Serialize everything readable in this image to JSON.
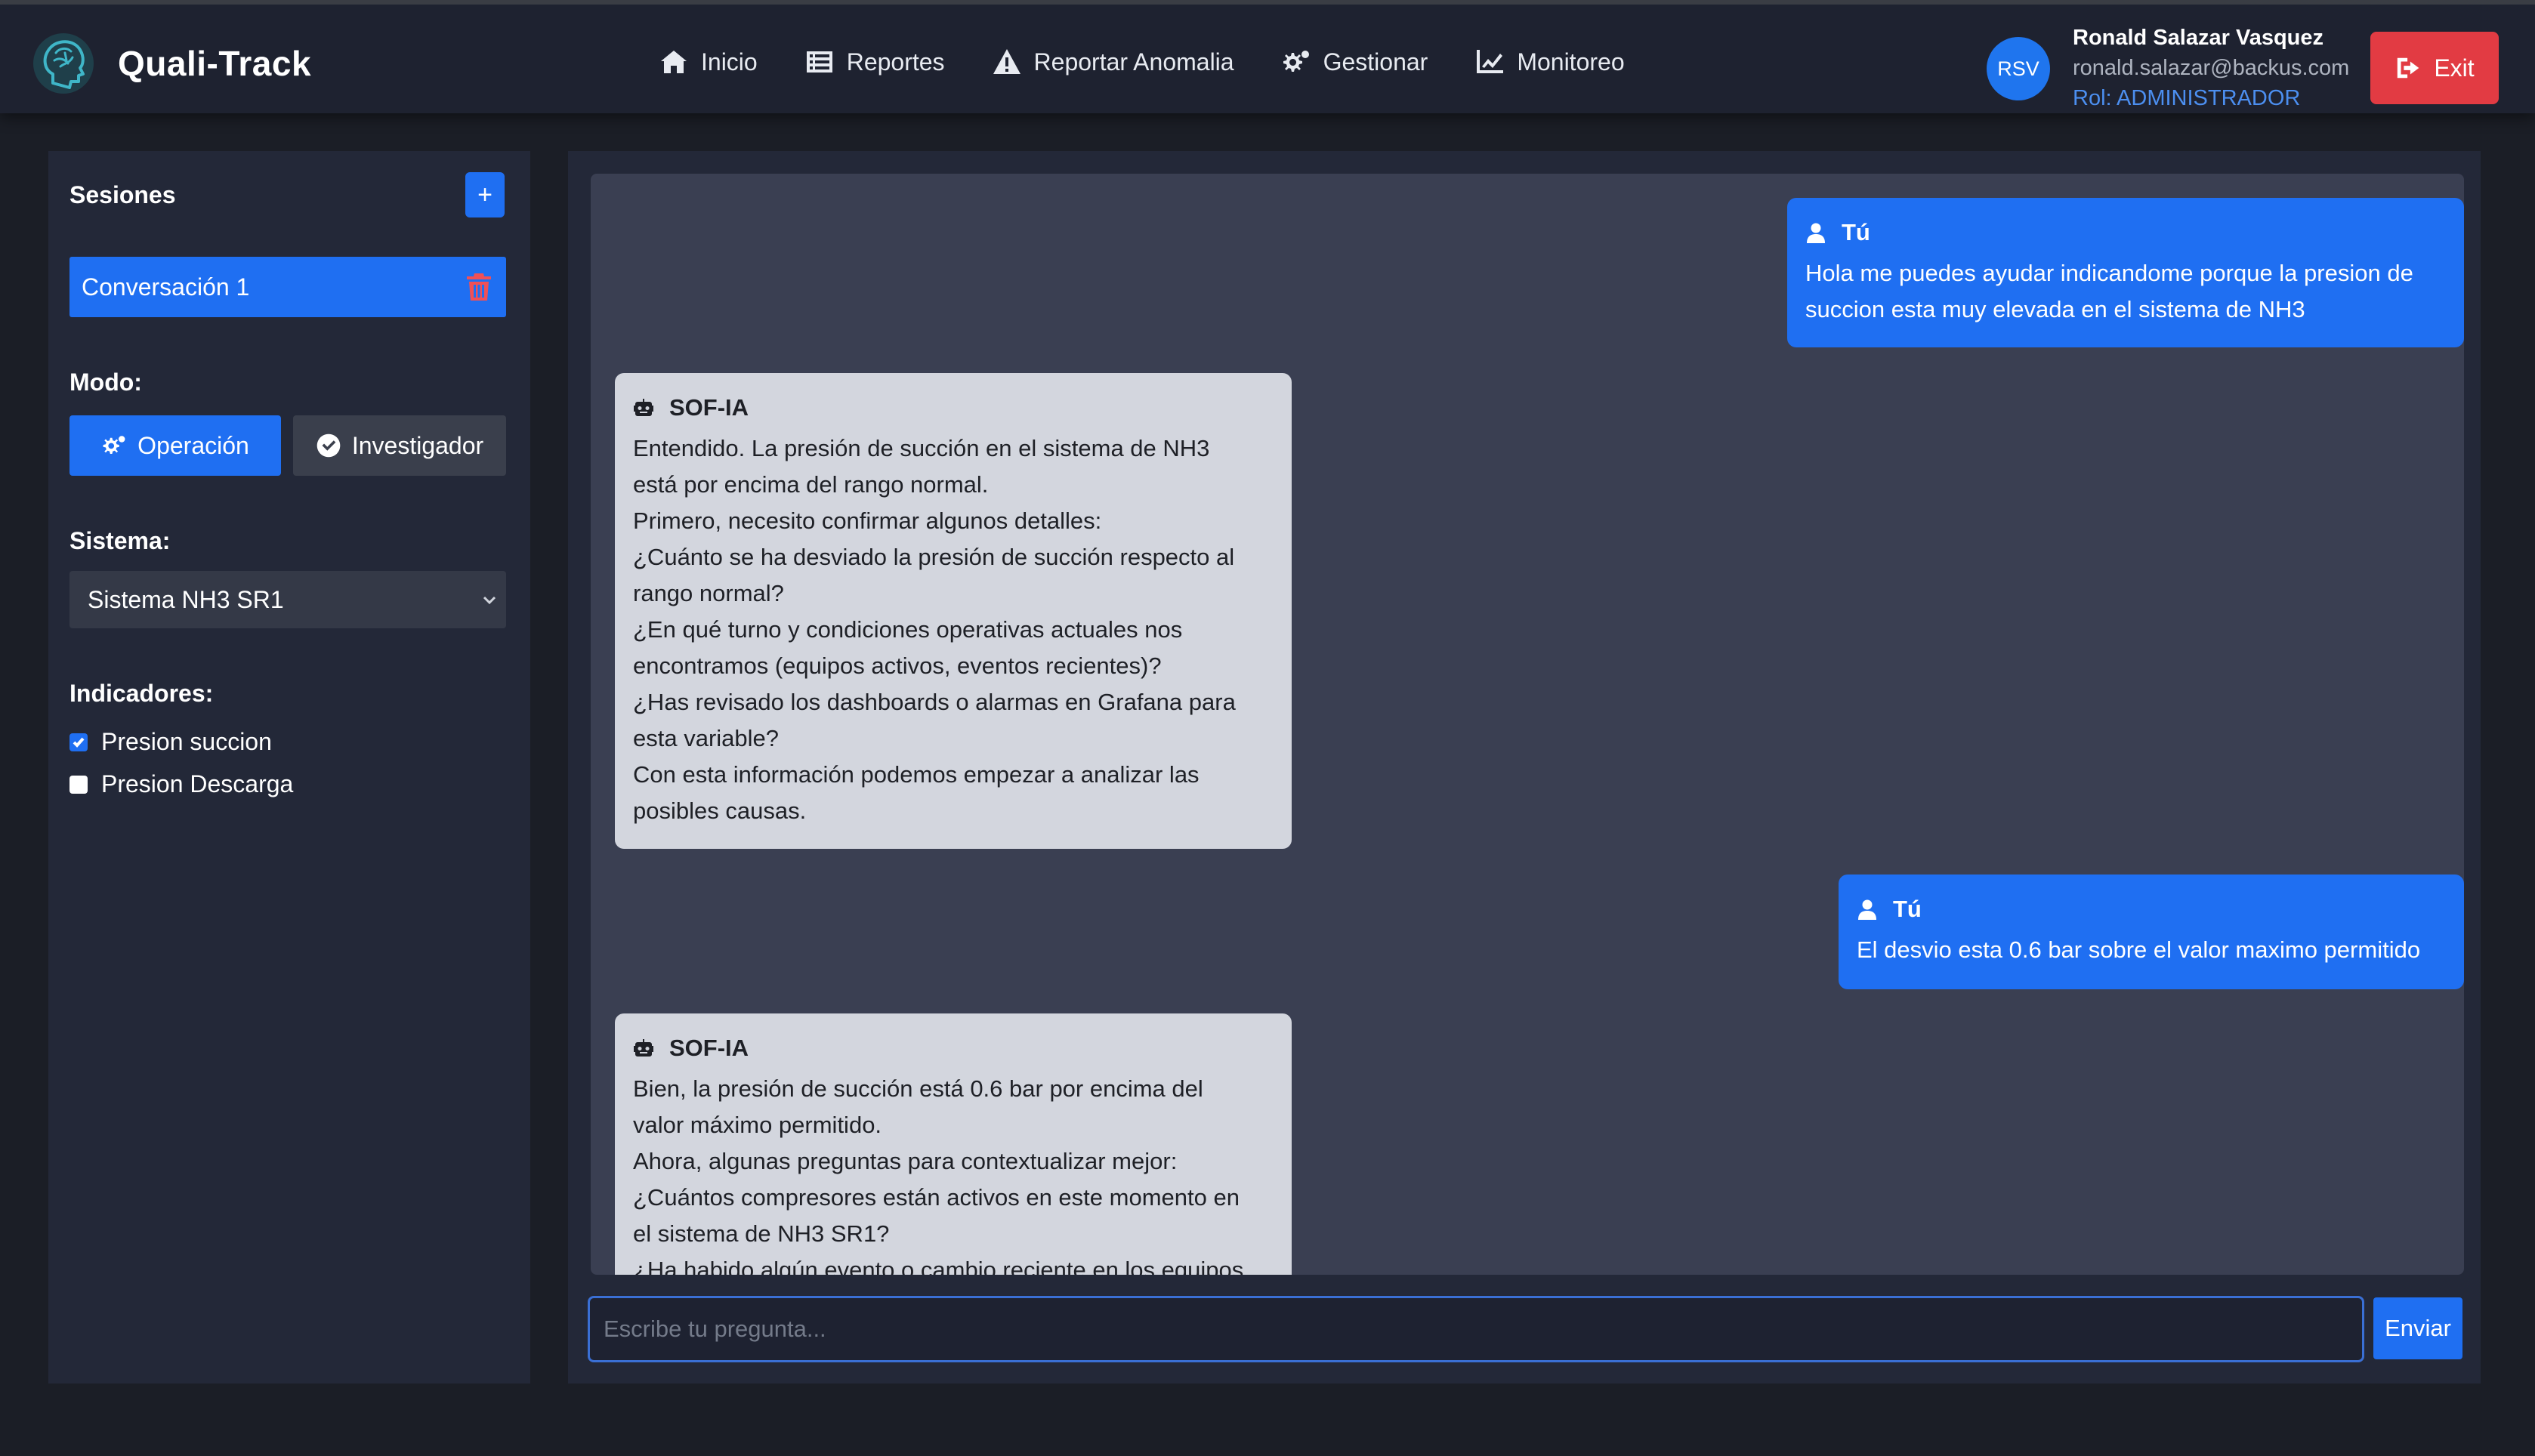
{
  "app": {
    "name": "Quali-Track"
  },
  "nav": {
    "items": [
      {
        "label": "Inicio",
        "icon": "home-icon"
      },
      {
        "label": "Reportes",
        "icon": "list-icon"
      },
      {
        "label": "Reportar Anomalia",
        "icon": "warning-icon"
      },
      {
        "label": "Gestionar",
        "icon": "gears-icon"
      },
      {
        "label": "Monitoreo",
        "icon": "chart-line-icon"
      }
    ]
  },
  "user": {
    "initials": "RSV",
    "name": "Ronald Salazar Vasquez",
    "email": "ronald.salazar@backus.com",
    "role": "Rol: ADMINISTRADOR",
    "exit_label": "Exit"
  },
  "sidebar": {
    "sessions_title": "Sesiones",
    "new_session_label": "+",
    "sessions": [
      {
        "label": "Conversación 1",
        "active": true
      }
    ],
    "mode_title": "Modo:",
    "modes": [
      {
        "label": "Operación",
        "active": true,
        "icon": "gears-icon"
      },
      {
        "label": "Investigador",
        "active": false,
        "icon": "check-circle-icon"
      }
    ],
    "system_title": "Sistema:",
    "system_selected": "Sistema NH3 SR1",
    "indicators_title": "Indicadores:",
    "indicators": [
      {
        "label": "Presion succion",
        "checked": true
      },
      {
        "label": "Presion Descarga",
        "checked": false
      }
    ]
  },
  "chat": {
    "messages": [
      {
        "sender": "Tú",
        "role": "user",
        "lines": [
          "Hola me puedes ayudar indicandome porque la presion de",
          "succion esta muy elevada en el sistema de NH3"
        ]
      },
      {
        "sender": "SOF-IA",
        "role": "bot",
        "lines": [
          "Entendido. La presión de succión en el sistema de NH3",
          "está por encima del rango normal.",
          "Primero, necesito confirmar algunos detalles:",
          "¿Cuánto se ha desviado la presión de succión respecto al",
          "rango normal?",
          "¿En qué turno y condiciones operativas actuales nos",
          "encontramos (equipos activos, eventos recientes)?",
          "¿Has revisado los dashboards o alarmas en Grafana para",
          "esta variable?",
          "Con esta información podemos empezar a analizar las",
          "posibles causas."
        ]
      },
      {
        "sender": "Tú",
        "role": "user",
        "lines": [
          "El desvio esta 0.6 bar sobre el valor maximo permitido"
        ]
      },
      {
        "sender": "SOF-IA",
        "role": "bot",
        "lines": [
          "Bien, la presión de succión está 0.6 bar por encima del",
          "valor máximo permitido.",
          "Ahora, algunas preguntas para contextualizar mejor:",
          "¿Cuántos compresores están activos en este momento en",
          "el sistema de NH3 SR1?",
          "¿Ha habido algún evento o cambio reciente en los equipos"
        ]
      }
    ],
    "input_placeholder": "Escribe tu pregunta...",
    "input_value": "",
    "send_label": "Enviar"
  },
  "colors": {
    "accent": "#1f6ff2",
    "danger": "#e23b43",
    "navbar_bg": "#1e2230",
    "panel_bg": "#232838",
    "chat_bg": "#3a3f52",
    "bot_bubble": "#d3d6de"
  }
}
